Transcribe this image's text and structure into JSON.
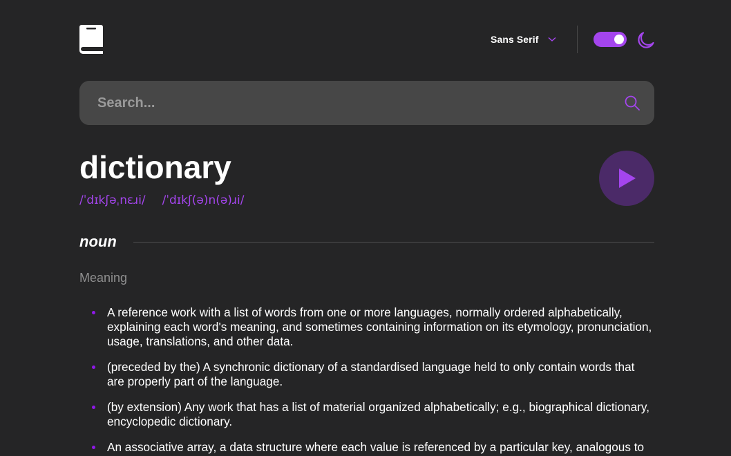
{
  "header": {
    "logo_icon": "book-icon",
    "font_selector": {
      "label": "Sans Serif",
      "icon": "chevron-down-icon"
    },
    "theme_toggle": {
      "state": "on",
      "icon": "moon-icon"
    }
  },
  "search": {
    "placeholder": "Search...",
    "value": "",
    "icon": "search-icon"
  },
  "entry": {
    "word": "dictionary",
    "phonetics": [
      "/ˈdɪkʃəˌnɛɹi/",
      "/ˈdɪkʃ(ə)n(ə)ɹi/"
    ],
    "play_icon": "play-icon",
    "part_of_speech": "noun",
    "meaning_label": "Meaning",
    "definitions": [
      "A reference work with a list of words from one or more languages, normally ordered alphabetically, explaining each word's meaning, and sometimes containing information on its etymology, pronunciation, usage, translations, and other data.",
      "(preceded by the) A synchronic dictionary of a standardised language held to only contain words that are properly part of the language.",
      "(by extension) Any work that has a list of material organized alphabetically; e.g., biographical dictionary, encyclopedic dictionary.",
      "An associative array, a data structure where each value is referenced by a particular key, analogous to"
    ]
  },
  "colors": {
    "background": "#252526",
    "accent": "#a445ed",
    "search_bg": "#474747",
    "play_bg": "#4b2a68",
    "muted_text": "#8f8f8f"
  }
}
